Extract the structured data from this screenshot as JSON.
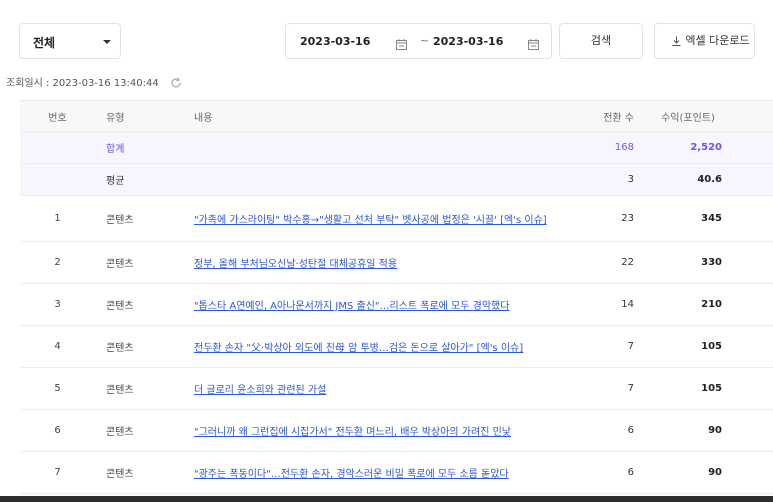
{
  "filter": {
    "category_selected": "전체",
    "date_start": "2023-03-16",
    "date_separator": "~",
    "date_end": "2023-03-16",
    "search_label": "검색",
    "excel_label": "엑셀 다운로드"
  },
  "lookup": {
    "text": "조회일시 : 2023-03-16 13:40:44"
  },
  "table": {
    "headers": {
      "no": "번호",
      "type": "유형",
      "content": "내용",
      "conversions": "전환 수",
      "revenue": "수익(포인트)"
    },
    "summary": {
      "label": "합계",
      "conversions": "168",
      "revenue": "2,520"
    },
    "average": {
      "label": "평균",
      "conversions": "3",
      "revenue": "40.6"
    },
    "rows": [
      {
        "no": "1",
        "type": "콘텐츠",
        "content": "\"가족에 가스라이팅\" 박수홍→\"생활고 선처 부탁\" 벳사공에 법정은 '시끌' [엑's 이슈]",
        "conversions": "23",
        "revenue": "345"
      },
      {
        "no": "2",
        "type": "콘텐츠",
        "content": "정부, 올해 부처님오신날·성탄절 대체공휴일 적용",
        "conversions": "22",
        "revenue": "330"
      },
      {
        "no": "3",
        "type": "콘텐츠",
        "content": "\"톱스타 A연예인, A아나운서까지 JMS 출신\"…리스트 폭로에 모두 경악했다",
        "conversions": "14",
        "revenue": "210"
      },
      {
        "no": "4",
        "type": "콘텐츠",
        "content": "전두환 손자 \"父·박상아 외도에 친母 암 투병…검은 돈으로 살아가\" [엑's 이슈]",
        "conversions": "7",
        "revenue": "105"
      },
      {
        "no": "5",
        "type": "콘텐츠",
        "content": "더 글로리 윤소희와 관련된 가설",
        "conversions": "7",
        "revenue": "105"
      },
      {
        "no": "6",
        "type": "콘텐츠",
        "content": "\"그러니까 왜 그런집에 시집가서\" 전두환 며느리, 배우 박상아의 가려진 민낯",
        "conversions": "6",
        "revenue": "90"
      },
      {
        "no": "7",
        "type": "콘텐츠",
        "content": "\"광주는 폭동이다\"…전두환 손자, 경악스러운 비밀 폭로에 모두 소름 돋았다",
        "conversions": "6",
        "revenue": "90"
      }
    ]
  },
  "colors": {
    "accent": "#6b5bd6",
    "link": "#2b57d9",
    "summary_bg": "#f7f6ff",
    "header_bg": "#f8f8f8"
  }
}
